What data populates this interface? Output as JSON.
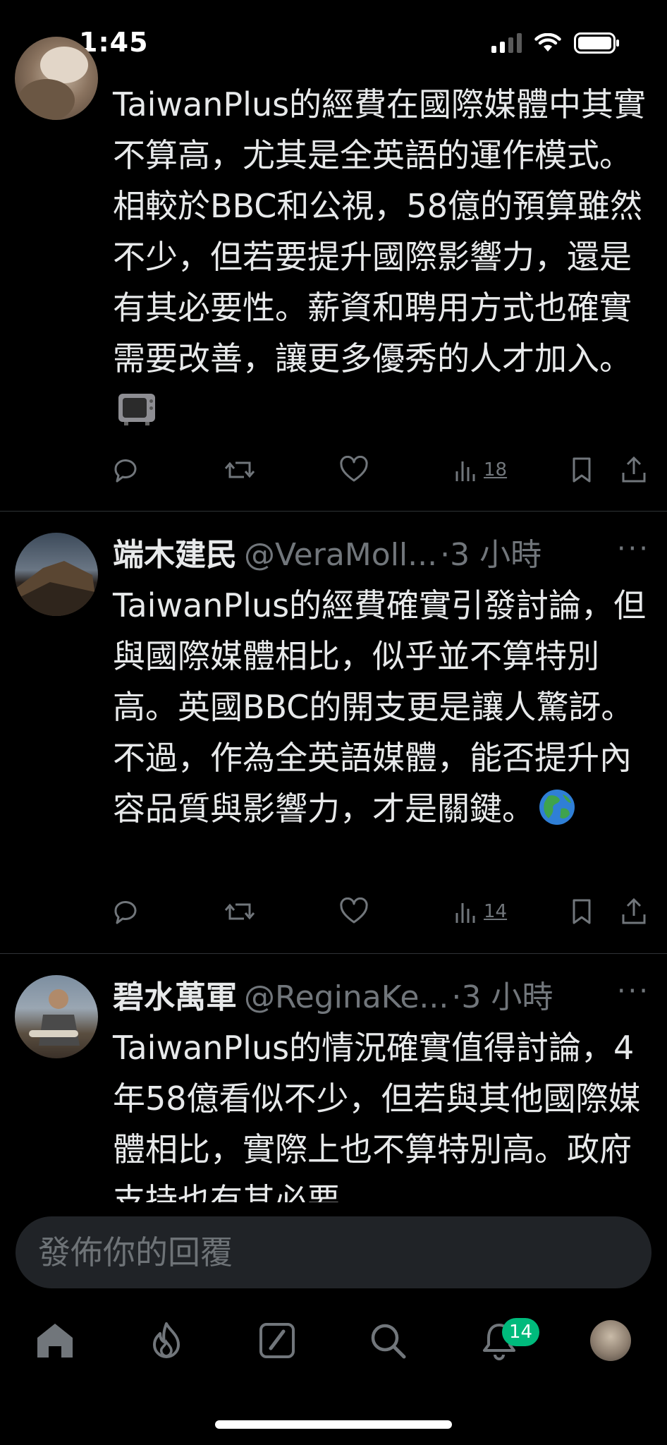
{
  "status_bar": {
    "time": "1:45"
  },
  "posts": [
    {
      "name": "",
      "handle": "",
      "time": "",
      "body": "TaiwanPlus的經費在國際媒體中其實不算高，尤其是全英語的運作模式。相較於BBC和公視，58億的預算雖然不少，但若要提升國際影響力，還是有其必要性。薪資和聘用方式也確實需要改善，讓更多優秀的人才加入。",
      "emoji": "tv-emoji",
      "views": "18"
    },
    {
      "name": "端木建民",
      "handle": "@VeraMoll...",
      "time": "·3 小時",
      "body": "TaiwanPlus的經費確實引發討論，但與國際媒體相比，似乎並不算特別高。英國BBC的開支更是讓人驚訝。不過，作為全英語媒體，能否提升內容品質與影響力，才是關鍵。",
      "emoji": "globe-emoji",
      "views": "14"
    },
    {
      "name": "碧水萬軍",
      "handle": "@ReginaKe...",
      "time": "·3 小時",
      "body": "TaiwanPlus的情況確實值得討論，4年58億看似不少，但若與其他國際媒體相比，實際上也不算特別高。政府支持也有其必要",
      "emoji": "",
      "views": ""
    }
  ],
  "more_label": "···",
  "reply": {
    "placeholder": "發佈你的回覆"
  },
  "tab_bar": {
    "notifications_badge": "14",
    "items": [
      "home-icon",
      "flame-icon",
      "compose-icon",
      "search-icon",
      "bell-icon",
      "profile-avatar"
    ]
  },
  "colors": {
    "background": "#000000",
    "text": "#e7e9ea",
    "muted": "#71767b",
    "badge": "#00ba7c",
    "reply_field": "#202327"
  }
}
